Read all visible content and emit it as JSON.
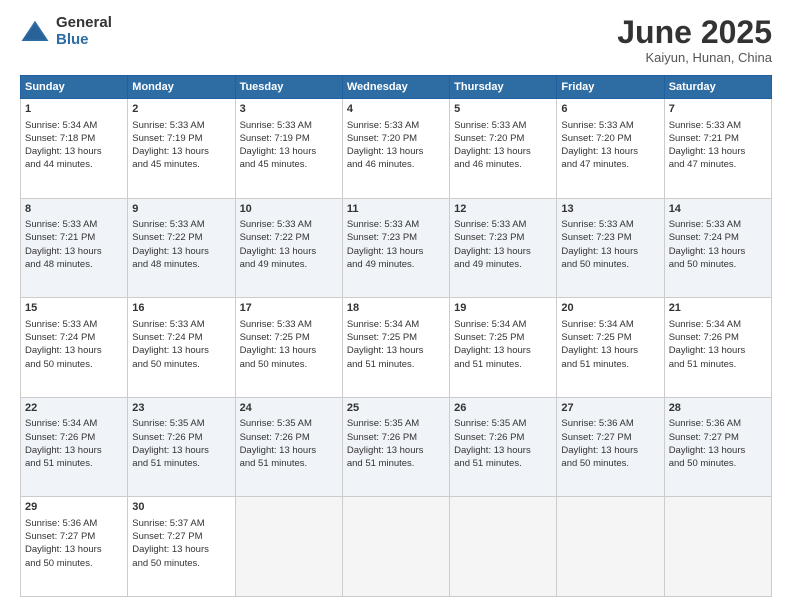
{
  "header": {
    "logo_general": "General",
    "logo_blue": "Blue",
    "month_title": "June 2025",
    "location": "Kaiyun, Hunan, China"
  },
  "weekdays": [
    "Sunday",
    "Monday",
    "Tuesday",
    "Wednesday",
    "Thursday",
    "Friday",
    "Saturday"
  ],
  "weeks": [
    [
      {
        "day": "1",
        "lines": [
          "Sunrise: 5:34 AM",
          "Sunset: 7:18 PM",
          "Daylight: 13 hours",
          "and 44 minutes."
        ]
      },
      {
        "day": "2",
        "lines": [
          "Sunrise: 5:33 AM",
          "Sunset: 7:19 PM",
          "Daylight: 13 hours",
          "and 45 minutes."
        ]
      },
      {
        "day": "3",
        "lines": [
          "Sunrise: 5:33 AM",
          "Sunset: 7:19 PM",
          "Daylight: 13 hours",
          "and 45 minutes."
        ]
      },
      {
        "day": "4",
        "lines": [
          "Sunrise: 5:33 AM",
          "Sunset: 7:20 PM",
          "Daylight: 13 hours",
          "and 46 minutes."
        ]
      },
      {
        "day": "5",
        "lines": [
          "Sunrise: 5:33 AM",
          "Sunset: 7:20 PM",
          "Daylight: 13 hours",
          "and 46 minutes."
        ]
      },
      {
        "day": "6",
        "lines": [
          "Sunrise: 5:33 AM",
          "Sunset: 7:20 PM",
          "Daylight: 13 hours",
          "and 47 minutes."
        ]
      },
      {
        "day": "7",
        "lines": [
          "Sunrise: 5:33 AM",
          "Sunset: 7:21 PM",
          "Daylight: 13 hours",
          "and 47 minutes."
        ]
      }
    ],
    [
      {
        "day": "8",
        "lines": [
          "Sunrise: 5:33 AM",
          "Sunset: 7:21 PM",
          "Daylight: 13 hours",
          "and 48 minutes."
        ]
      },
      {
        "day": "9",
        "lines": [
          "Sunrise: 5:33 AM",
          "Sunset: 7:22 PM",
          "Daylight: 13 hours",
          "and 48 minutes."
        ]
      },
      {
        "day": "10",
        "lines": [
          "Sunrise: 5:33 AM",
          "Sunset: 7:22 PM",
          "Daylight: 13 hours",
          "and 49 minutes."
        ]
      },
      {
        "day": "11",
        "lines": [
          "Sunrise: 5:33 AM",
          "Sunset: 7:23 PM",
          "Daylight: 13 hours",
          "and 49 minutes."
        ]
      },
      {
        "day": "12",
        "lines": [
          "Sunrise: 5:33 AM",
          "Sunset: 7:23 PM",
          "Daylight: 13 hours",
          "and 49 minutes."
        ]
      },
      {
        "day": "13",
        "lines": [
          "Sunrise: 5:33 AM",
          "Sunset: 7:23 PM",
          "Daylight: 13 hours",
          "and 50 minutes."
        ]
      },
      {
        "day": "14",
        "lines": [
          "Sunrise: 5:33 AM",
          "Sunset: 7:24 PM",
          "Daylight: 13 hours",
          "and 50 minutes."
        ]
      }
    ],
    [
      {
        "day": "15",
        "lines": [
          "Sunrise: 5:33 AM",
          "Sunset: 7:24 PM",
          "Daylight: 13 hours",
          "and 50 minutes."
        ]
      },
      {
        "day": "16",
        "lines": [
          "Sunrise: 5:33 AM",
          "Sunset: 7:24 PM",
          "Daylight: 13 hours",
          "and 50 minutes."
        ]
      },
      {
        "day": "17",
        "lines": [
          "Sunrise: 5:33 AM",
          "Sunset: 7:25 PM",
          "Daylight: 13 hours",
          "and 50 minutes."
        ]
      },
      {
        "day": "18",
        "lines": [
          "Sunrise: 5:34 AM",
          "Sunset: 7:25 PM",
          "Daylight: 13 hours",
          "and 51 minutes."
        ]
      },
      {
        "day": "19",
        "lines": [
          "Sunrise: 5:34 AM",
          "Sunset: 7:25 PM",
          "Daylight: 13 hours",
          "and 51 minutes."
        ]
      },
      {
        "day": "20",
        "lines": [
          "Sunrise: 5:34 AM",
          "Sunset: 7:25 PM",
          "Daylight: 13 hours",
          "and 51 minutes."
        ]
      },
      {
        "day": "21",
        "lines": [
          "Sunrise: 5:34 AM",
          "Sunset: 7:26 PM",
          "Daylight: 13 hours",
          "and 51 minutes."
        ]
      }
    ],
    [
      {
        "day": "22",
        "lines": [
          "Sunrise: 5:34 AM",
          "Sunset: 7:26 PM",
          "Daylight: 13 hours",
          "and 51 minutes."
        ]
      },
      {
        "day": "23",
        "lines": [
          "Sunrise: 5:35 AM",
          "Sunset: 7:26 PM",
          "Daylight: 13 hours",
          "and 51 minutes."
        ]
      },
      {
        "day": "24",
        "lines": [
          "Sunrise: 5:35 AM",
          "Sunset: 7:26 PM",
          "Daylight: 13 hours",
          "and 51 minutes."
        ]
      },
      {
        "day": "25",
        "lines": [
          "Sunrise: 5:35 AM",
          "Sunset: 7:26 PM",
          "Daylight: 13 hours",
          "and 51 minutes."
        ]
      },
      {
        "day": "26",
        "lines": [
          "Sunrise: 5:35 AM",
          "Sunset: 7:26 PM",
          "Daylight: 13 hours",
          "and 51 minutes."
        ]
      },
      {
        "day": "27",
        "lines": [
          "Sunrise: 5:36 AM",
          "Sunset: 7:27 PM",
          "Daylight: 13 hours",
          "and 50 minutes."
        ]
      },
      {
        "day": "28",
        "lines": [
          "Sunrise: 5:36 AM",
          "Sunset: 7:27 PM",
          "Daylight: 13 hours",
          "and 50 minutes."
        ]
      }
    ],
    [
      {
        "day": "29",
        "lines": [
          "Sunrise: 5:36 AM",
          "Sunset: 7:27 PM",
          "Daylight: 13 hours",
          "and 50 minutes."
        ]
      },
      {
        "day": "30",
        "lines": [
          "Sunrise: 5:37 AM",
          "Sunset: 7:27 PM",
          "Daylight: 13 hours",
          "and 50 minutes."
        ]
      },
      {
        "day": "",
        "lines": []
      },
      {
        "day": "",
        "lines": []
      },
      {
        "day": "",
        "lines": []
      },
      {
        "day": "",
        "lines": []
      },
      {
        "day": "",
        "lines": []
      }
    ]
  ]
}
